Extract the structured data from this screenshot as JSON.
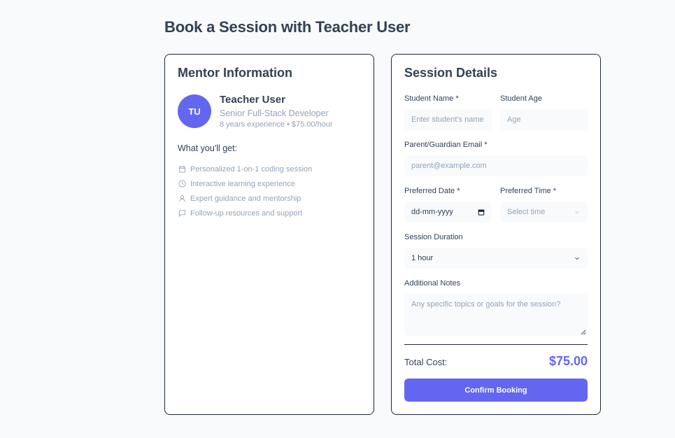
{
  "page_title": "Book a Session with Teacher User",
  "mentor": {
    "card_title": "Mentor Information",
    "initials": "TU",
    "name": "Teacher User",
    "role": "Senior Full-Stack Developer",
    "meta": "8 years experience • $75.00/hour",
    "benefits_heading": "What you'll get:",
    "benefits": [
      {
        "icon": "calendar-icon",
        "label": "Personalized 1-on-1 coding session"
      },
      {
        "icon": "clock-icon",
        "label": "Interactive learning experience"
      },
      {
        "icon": "user-icon",
        "label": "Expert guidance and mentorship"
      },
      {
        "icon": "chat-icon",
        "label": "Follow-up resources and support"
      }
    ]
  },
  "session": {
    "card_title": "Session Details",
    "student_name_label": "Student Name *",
    "student_name_placeholder": "Enter student's name",
    "student_age_label": "Student Age",
    "student_age_placeholder": "Age",
    "email_label": "Parent/Guardian Email *",
    "email_placeholder": "parent@example.com",
    "date_label": "Preferred Date *",
    "date_placeholder": "dd-mm-yyyy",
    "time_label": "Preferred Time *",
    "time_placeholder": "Select time",
    "duration_label": "Session Duration",
    "duration_value": "1 hour",
    "notes_label": "Additional Notes",
    "notes_placeholder": "Any specific topics or goals for the session?",
    "total_label": "Total Cost:",
    "total_amount": "$75.00",
    "confirm_label": "Confirm Booking"
  },
  "colors": {
    "accent": "#6366f1",
    "text": "#334155",
    "muted": "#94a3b8",
    "background": "#f8fafc"
  }
}
